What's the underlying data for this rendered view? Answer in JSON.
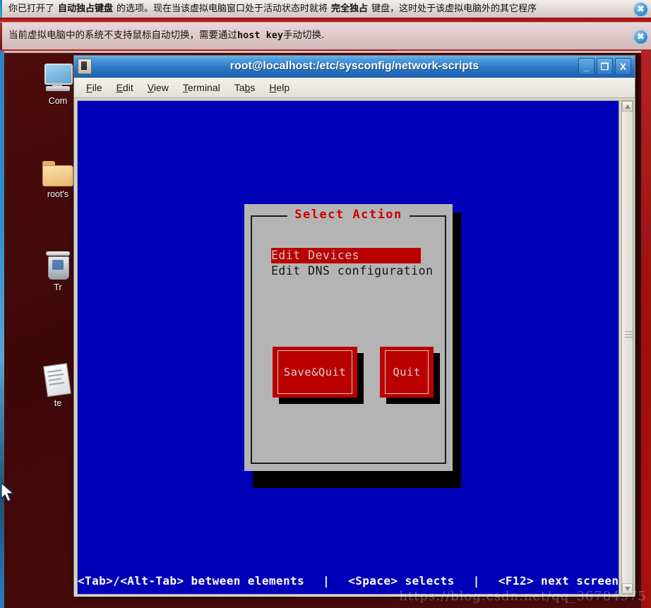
{
  "banners": [
    {
      "id": "keyboard-capture-notice",
      "segments": [
        {
          "text": "你已打开了",
          "bold": false
        },
        {
          "text": "自动独占键盘",
          "bold": true
        },
        {
          "text": "的选项。现在当该虚拟电脑窗口处于活动状态时就将",
          "bold": false
        },
        {
          "text": "完全独占",
          "bold": true
        },
        {
          "text": "键盘，这时处于该虚拟电脑外的其它程序",
          "bold": false
        }
      ],
      "close_label": "✖"
    },
    {
      "id": "mouse-integration-notice",
      "segments": [
        {
          "text": "当前虚拟电脑中的系统不支持鼠标自动切换，需要通过",
          "bold": false
        },
        {
          "text": "host key",
          "bold": true,
          "mono": true
        },
        {
          "text": "手动切换.",
          "bold": false
        }
      ],
      "close_label": "✖"
    }
  ],
  "desktop": {
    "icons": [
      {
        "name": "computer",
        "label": "Com"
      },
      {
        "name": "root-home",
        "label": "root's"
      },
      {
        "name": "trash",
        "label": "Tr"
      },
      {
        "name": "text-file",
        "label": "te"
      }
    ]
  },
  "terminal": {
    "title": "root@localhost:/etc/sysconfig/network-scripts",
    "window_buttons": {
      "minimize": "_",
      "maximize": "❐",
      "close": "X"
    },
    "menu": [
      {
        "pre": "",
        "mnemonic": "F",
        "post": "ile"
      },
      {
        "pre": "",
        "mnemonic": "E",
        "post": "dit"
      },
      {
        "pre": "",
        "mnemonic": "V",
        "post": "iew"
      },
      {
        "pre": "",
        "mnemonic": "T",
        "post": "erminal"
      },
      {
        "pre": "Ta",
        "mnemonic": "b",
        "post": "s"
      },
      {
        "pre": "",
        "mnemonic": "H",
        "post": "elp"
      }
    ]
  },
  "dialog": {
    "title": "Select Action",
    "items": [
      {
        "label": "Edit Devices",
        "selected": true
      },
      {
        "label": "Edit DNS configuration",
        "selected": false
      }
    ],
    "buttons": [
      {
        "id": "save-quit",
        "label": "Save&Quit"
      },
      {
        "id": "quit",
        "label": "Quit"
      }
    ]
  },
  "statusbar": {
    "hint1": "<Tab>/<Alt-Tab> between elements",
    "divider": "|",
    "hint2": "<Space> selects",
    "hint3": "<F12> next screen"
  },
  "watermark": "https://blog.csdn.net/qq_36784975",
  "colors": {
    "terminal_blue": "#0000b8",
    "dialog_gray": "#b4b4b4",
    "tui_red": "#bb0000",
    "title_red": "#cc0000",
    "desktop_maroon": "#4a0b0b",
    "host_red": "#c3161c",
    "titlebar_blue": "#2c79c8"
  }
}
